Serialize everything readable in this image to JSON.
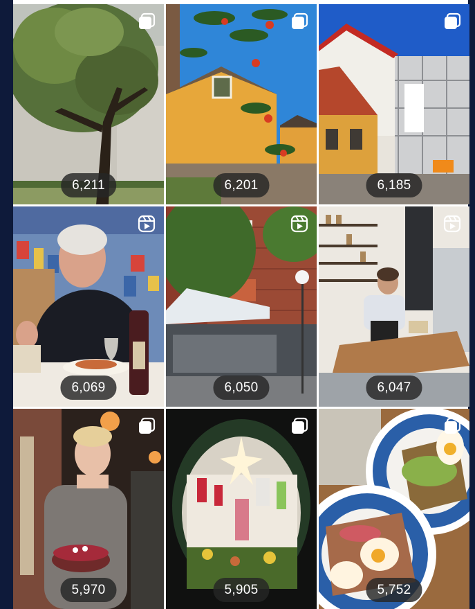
{
  "grid": {
    "posts": [
      {
        "count": "6,211",
        "type_icon": "carousel-icon",
        "scene": "large tree in front of stone church"
      },
      {
        "count": "6,201",
        "type_icon": "carousel-icon",
        "scene": "yellow house with rowan berries"
      },
      {
        "count": "6,185",
        "type_icon": "carousel-icon",
        "scene": "street with scaffolded building"
      },
      {
        "count": "6,069",
        "type_icon": "reel-icon",
        "scene": "man dining with wine"
      },
      {
        "count": "6,050",
        "type_icon": "reel-icon",
        "scene": "brick cafe with awning"
      },
      {
        "count": "6,047",
        "type_icon": "reel-icon",
        "scene": "woman at wooden counter"
      },
      {
        "count": "5,970",
        "type_icon": "carousel-icon",
        "scene": "chef holding cake"
      },
      {
        "count": "5,905",
        "type_icon": "carousel-icon",
        "scene": "shop window display with star"
      },
      {
        "count": "5,752",
        "type_icon": "carousel-icon",
        "scene": "plates of open sandwiches"
      }
    ]
  },
  "colors": {
    "background": "#0e1a3a",
    "pill": "#262626"
  }
}
